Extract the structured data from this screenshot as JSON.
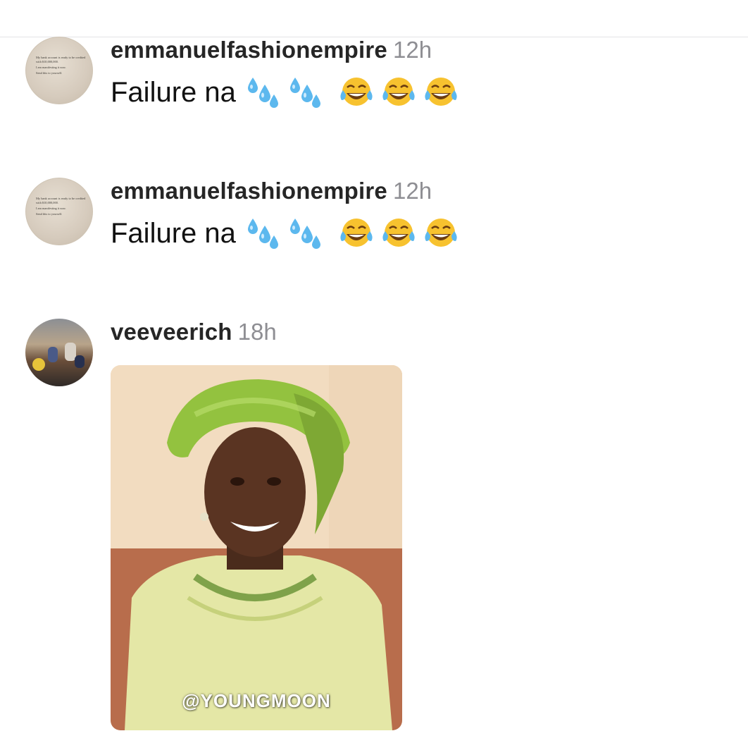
{
  "comments": [
    {
      "username": "emmanuelfashionempire",
      "time": "12h",
      "text": "Failure na",
      "avatar": {
        "type": "text-note",
        "lines": [
          "My bank account is ready to be credited with $10,000,000.",
          "I am manifesting it now.",
          "Send this to yourself."
        ]
      },
      "emojis": [
        "sweat-droplets",
        "sweat-droplets",
        "face-with-tears-of-joy",
        "face-with-tears-of-joy",
        "face-with-tears-of-joy"
      ]
    },
    {
      "username": "emmanuelfashionempire",
      "time": "12h",
      "text": "Failure na",
      "avatar": {
        "type": "text-note",
        "lines": [
          "My bank account is ready to be credited with $10,000,000.",
          "I am manifesting it now.",
          "Send this to yourself."
        ]
      },
      "emojis": [
        "sweat-droplets",
        "sweat-droplets",
        "face-with-tears-of-joy",
        "face-with-tears-of-joy",
        "face-with-tears-of-joy"
      ]
    },
    {
      "username": "veeveerich",
      "time": "18h",
      "avatar": {
        "type": "group-photo"
      },
      "gif": {
        "watermark": "@YOUNGMOON",
        "subject": "laughing woman in green head wrap"
      }
    }
  ],
  "colors": {
    "username": "#262626",
    "timestamp": "#8e8e93",
    "divider": "#e3e3e6",
    "emoji_yellow": "#f7c22f",
    "drop_blue": "#5cb8ee"
  }
}
